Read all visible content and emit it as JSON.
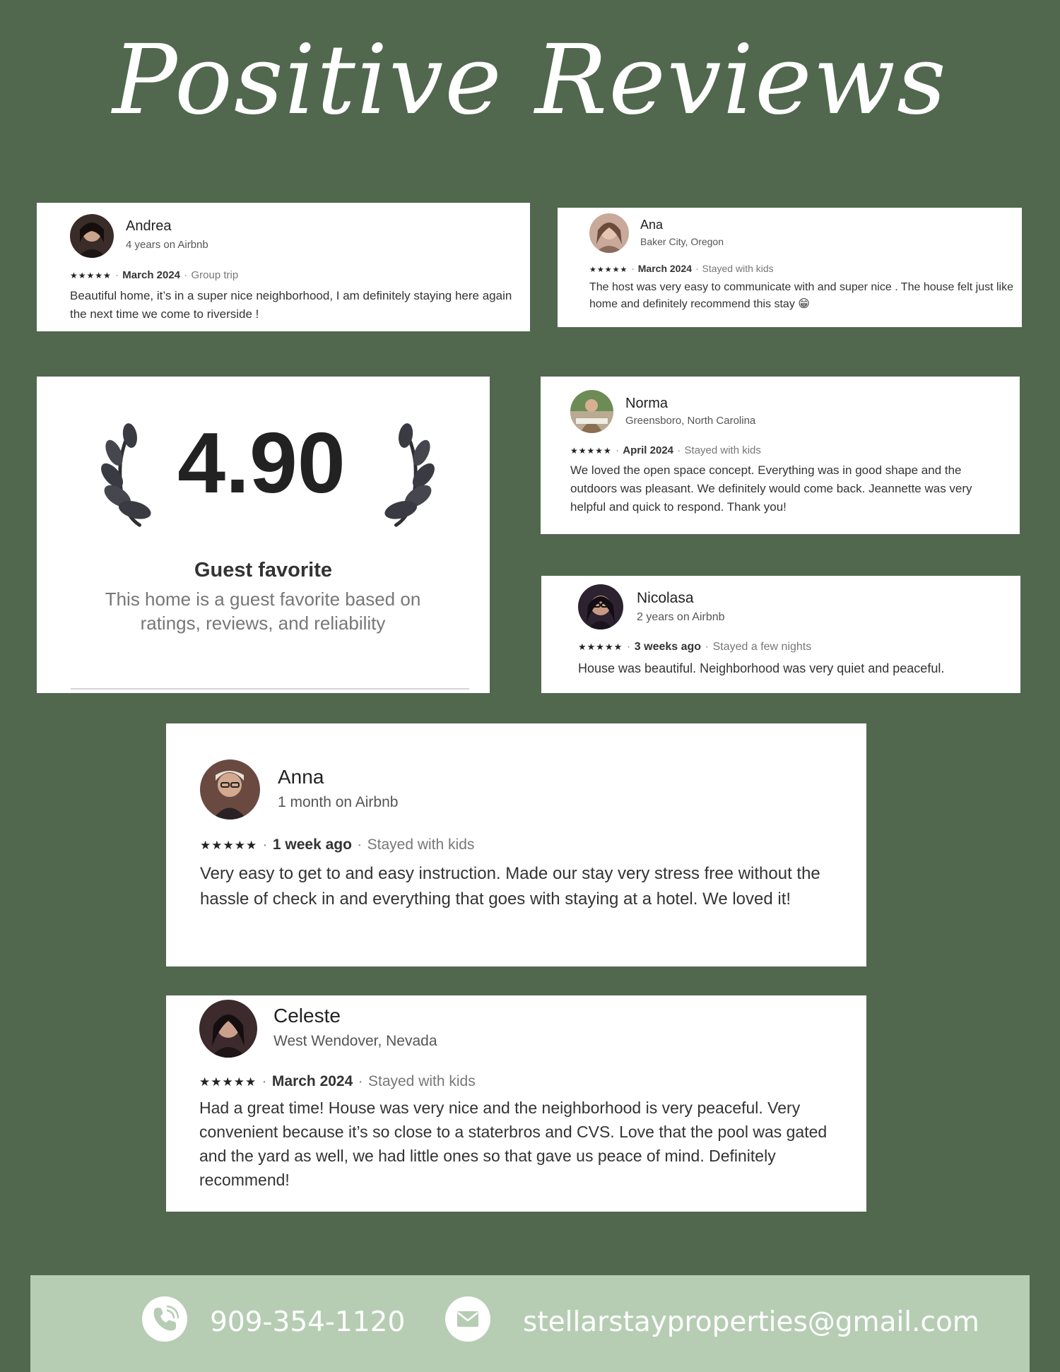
{
  "page": {
    "title": "Positive Reviews"
  },
  "icons": {
    "star": "star-icon",
    "phone": "phone-icon",
    "email": "envelope-icon",
    "laurel": "laurel-icon"
  },
  "colors": {
    "background": "#51684f",
    "footer": "#b6cdb4",
    "card": "#ffffff"
  },
  "reviews": [
    {
      "name": "Andrea",
      "subtitle": "4 years on Airbnb",
      "stars": "★★★★★",
      "rating": 5,
      "date": "March 2024",
      "trip": "Group trip",
      "text": "Beautiful home, it’s in a super nice neighborhood, I am definitely staying here again the next time we come to riverside !"
    },
    {
      "name": "Ana",
      "subtitle": "Baker City, Oregon",
      "stars": "★★★★★",
      "rating": 5,
      "date": "March 2024",
      "trip": "Stayed with kids",
      "text": "The host was very easy to communicate with and super nice . The house felt just like home and definitely recommend this stay 😁"
    },
    {
      "name": "Norma",
      "subtitle": "Greensboro, North Carolina",
      "stars": "★★★★★",
      "rating": 5,
      "date": "April 2024",
      "trip": "Stayed with kids",
      "text": "We loved the open space concept. Everything was in good shape and the outdoors was pleasant. We definitely would come back. Jeannette was very helpful and quick to respond. Thank you!"
    },
    {
      "name": "Nicolasa",
      "subtitle": "2 years on Airbnb",
      "stars": "★★★★★",
      "rating": 5,
      "date": "3 weeks ago",
      "trip": "Stayed a few nights",
      "text": "House was beautiful. Neighborhood was very quiet and peaceful."
    },
    {
      "name": "Anna",
      "subtitle": "1 month on Airbnb",
      "stars": "★★★★★",
      "rating": 5,
      "date": "1 week ago",
      "trip": "Stayed with kids",
      "text": "Very easy to get to and easy instruction. Made our stay very stress free without the hassle of check in and everything that goes with staying at a hotel. We loved it!"
    },
    {
      "name": "Celeste",
      "subtitle": "West Wendover, Nevada",
      "stars": "★★★★★",
      "rating": 5,
      "date": "March 2024",
      "trip": "Stayed with kids",
      "text": "Had a great time! House was very nice and the neighborhood is very peaceful. Very convenient because it’s so close to a staterbros and CVS. Love that the pool was gated and the yard as well, we had little ones so that gave us peace of mind. Definitely recommend!"
    }
  ],
  "guest_favorite": {
    "rating": "4.90",
    "title": "Guest favorite",
    "description": "This home is a guest favorite based on ratings, reviews, and reliability"
  },
  "footer": {
    "phone": "909-354-1120",
    "email": "stellarstayproperties@gmail.com"
  }
}
